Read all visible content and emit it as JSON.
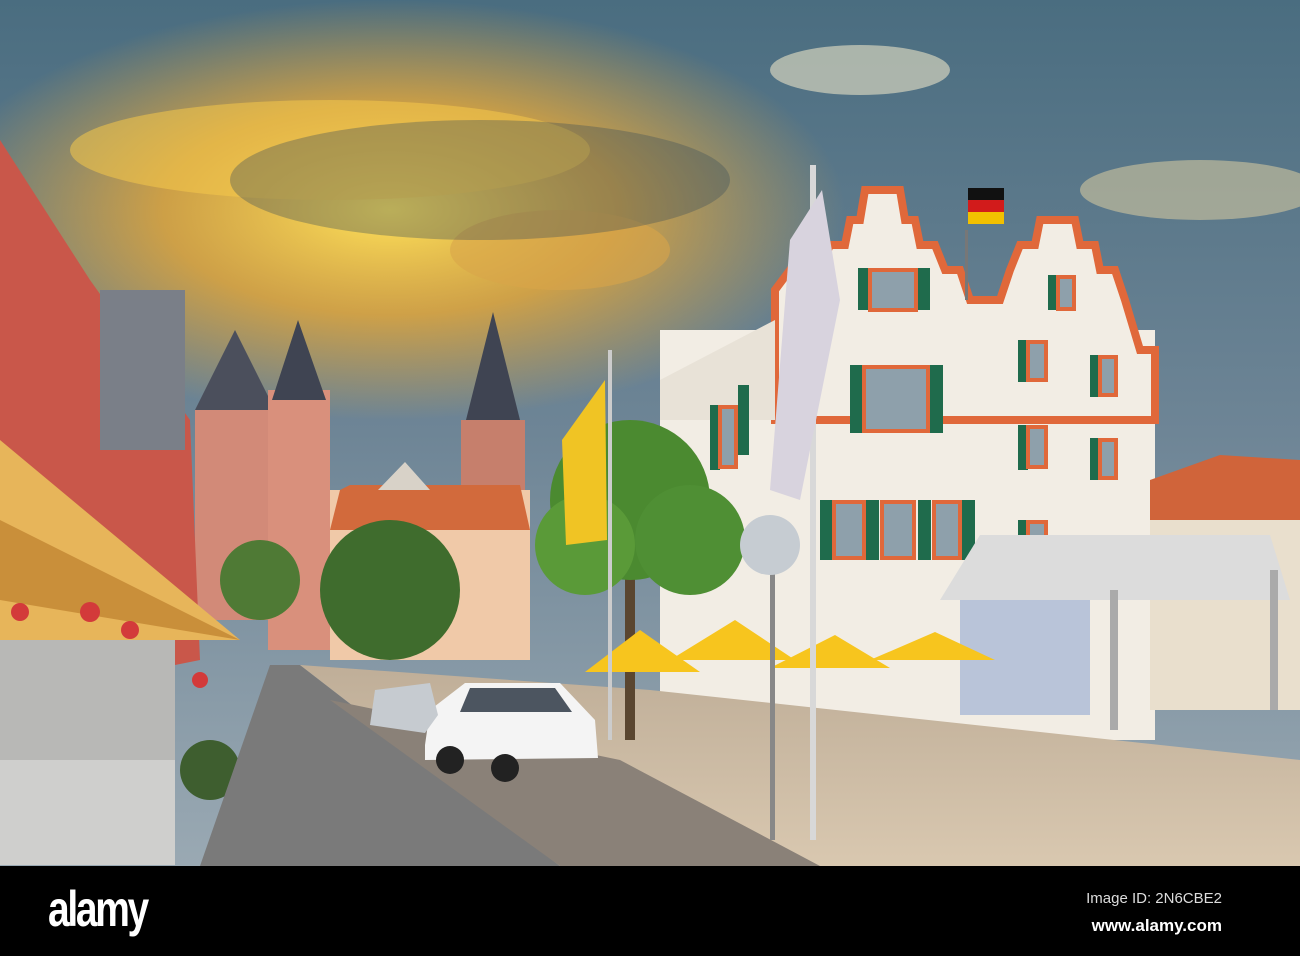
{
  "watermark": {
    "logo": "alamy",
    "image_id": "Image ID: 2N6CBE2",
    "website": "www.alamy.com"
  },
  "colors": {
    "sky_top": "#3f5f72",
    "sky_glow": "#f4c23a",
    "facade": "#f2ede4",
    "trim": "#e0683a",
    "shutter": "#1f6b4c",
    "umbrella": "#f7c51e",
    "church": "#d9907c"
  }
}
